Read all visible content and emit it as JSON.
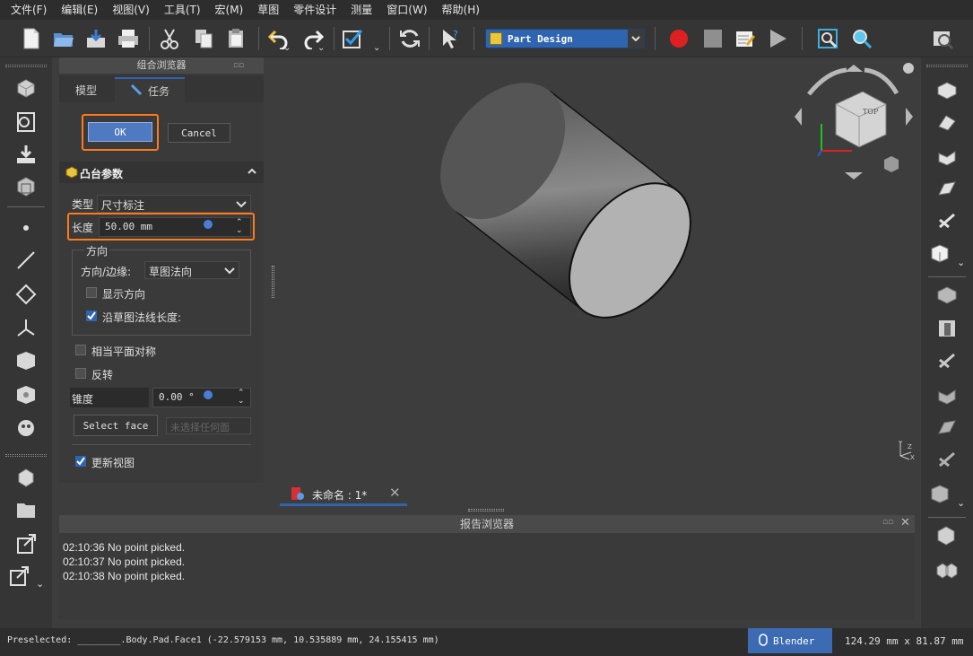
{
  "menu": [
    "文件(F)",
    "编辑(E)",
    "视图(V)",
    "工具(T)",
    "宏(M)",
    "草图",
    "零件设计",
    "测量",
    "窗口(W)",
    "帮助(H)"
  ],
  "workbench": {
    "label": "Part Design"
  },
  "combo": {
    "title": "组合浏览器",
    "tabs": {
      "model": "模型",
      "task": "任务"
    },
    "ok": "OK",
    "cancel": "Cancel",
    "section_title": "凸台参数",
    "type_label": "类型",
    "type_value": "尺寸标注",
    "length_label": "长度",
    "length_value": "50.00 mm",
    "direction_group": "方向",
    "dir_edge_label": "方向/边缘:",
    "dir_edge_value": "草图法向",
    "show_direction": "显示方向",
    "along_normal": "沿草图法线长度:",
    "symmetric": "相当平面对称",
    "reversed": "反转",
    "taper_label": "锥度",
    "taper_value": "0.00 °",
    "select_face": "Select face",
    "no_face": "未选择任何面",
    "update_view": "更新视图"
  },
  "checkboxes": {
    "show_direction": false,
    "along_normal": true,
    "symmetric": false,
    "reversed": false,
    "update_view": true
  },
  "navcube": {
    "face": "TOP"
  },
  "doc_tab": {
    "label": "未命名 : 1*"
  },
  "report": {
    "title": "报告浏览器",
    "lines": [
      "02:10:36  No point picked.",
      "02:10:37  No point picked.",
      "02:10:38  No point picked."
    ]
  },
  "status": {
    "preselected": "Preselected: ________.Body.Pad.Face1 (-22.579153 mm, 10.535889 mm, 24.155415 mm)",
    "nav_style": "Blender",
    "dimensions": "124.29 mm x 81.87 mm"
  },
  "colors": {
    "accent": "#2f64b0",
    "highlight": "#ff7a1a"
  },
  "icons": [
    "new-file-icon",
    "open-folder-icon",
    "save-icon",
    "print-icon",
    "cut-icon",
    "copy-icon",
    "paste-icon",
    "undo-icon",
    "redo-icon",
    "refresh-icon",
    "whats-this-icon",
    "record-macro-icon",
    "stop-macro-icon",
    "edit-macro-icon",
    "run-macro-icon",
    "fit-all-icon",
    "fit-selection-icon"
  ]
}
